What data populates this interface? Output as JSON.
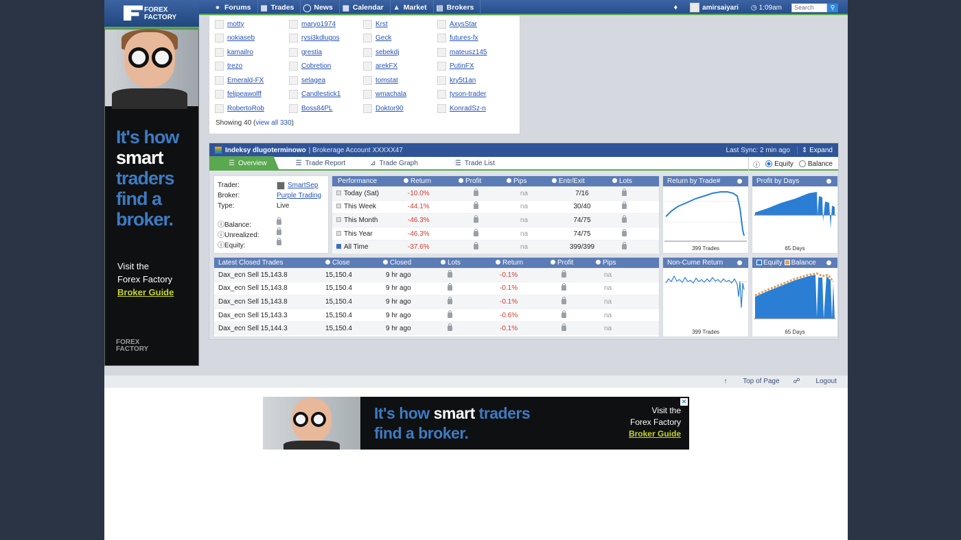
{
  "logo": {
    "line1": "FOREX",
    "line2": "FACTORY"
  },
  "nav": {
    "items": [
      {
        "label": "Forums",
        "icon": "chat-icon"
      },
      {
        "label": "Trades",
        "icon": "bars-icon"
      },
      {
        "label": "News",
        "icon": "globe-icon"
      },
      {
        "label": "Calendar",
        "icon": "calendar-icon"
      },
      {
        "label": "Market",
        "icon": "chart-icon"
      },
      {
        "label": "Brokers",
        "icon": "building-icon"
      }
    ],
    "username": "amirsaiyari",
    "time": "1:09am",
    "search_placeholder": "Search"
  },
  "side_ad": {
    "line1": "It's how",
    "line2": "smart",
    "line3": "traders",
    "line4": "find a",
    "line5": "broker.",
    "visit1": "Visit the",
    "visit2": "Forex Factory",
    "guide": "Broker Guide",
    "brand1": "FOREX",
    "brand2": "FACTORY"
  },
  "members": {
    "rows": [
      [
        "motty",
        "maryo1974",
        "Krst",
        "AxysStar"
      ],
      [
        "nokiaseb",
        "rysi3kdlugos",
        "Geck",
        "futures-fx"
      ],
      [
        "kamailro",
        "grestia",
        "sebekdj",
        "mateusz145"
      ],
      [
        "trezo",
        "Cobretion",
        "arekFX",
        "PutinFX"
      ],
      [
        "Emerald-FX",
        "selagea",
        "tomstat",
        "kry5t1an"
      ],
      [
        "felipeawolff",
        "Candlestick1",
        "wmachala",
        "tyson-trader"
      ],
      [
        "RobertoRob",
        "Boss84PL",
        "Doktor90",
        "KonradSz-n"
      ]
    ],
    "showing_prefix": "Showing 40 (",
    "view_all": "view all 330",
    "showing_suffix": ")"
  },
  "account": {
    "name": "Indeksy dlugoterminowo",
    "sub": "| Brokerage Account XXXXX47",
    "sync": "Last Sync: 2 min ago",
    "expand": "Expand",
    "tabs": [
      "Overview",
      "Trade Report",
      "Trade Graph",
      "Trade List"
    ],
    "toggle": {
      "equity": "Equity",
      "balance": "Balance"
    },
    "trader": {
      "trader_label": "Trader:",
      "trader_value": "SmartSep",
      "broker_label": "Broker:",
      "broker_value": "Purple Trading",
      "type_label": "Type:",
      "type_value": "Live",
      "balance_label": "Balance:",
      "unrealized_label": "Unrealized:",
      "equity_label": "Equity:"
    },
    "performance": {
      "headers": [
        "Performance",
        "Return",
        "Profit",
        "Pips",
        "Entr/Exit",
        "Lots"
      ],
      "rows": [
        {
          "period": "Today (Sat)",
          "return": "-10.0%",
          "pips": "na",
          "entr": "7/16"
        },
        {
          "period": "This Week",
          "return": "-44.1%",
          "pips": "na",
          "entr": "30/40"
        },
        {
          "period": "This Month",
          "return": "-46.3%",
          "pips": "na",
          "entr": "74/75"
        },
        {
          "period": "This Year",
          "return": "-46.3%",
          "pips": "na",
          "entr": "74/75"
        },
        {
          "period": "All Time",
          "return": "-37.6%",
          "pips": "na",
          "entr": "399/399"
        }
      ]
    },
    "closed": {
      "headers": [
        "Latest Closed Trades",
        "Close",
        "Closed",
        "Lots",
        "Return",
        "Profit",
        "Pips"
      ],
      "rows": [
        {
          "trade": "Dax_ecn Sell 15,143.8",
          "close": "15,150.4",
          "closed": "9 hr ago",
          "ret": "-0.1%",
          "pips": "na"
        },
        {
          "trade": "Dax_ecn Sell 15,143.8",
          "close": "15,150.4",
          "closed": "9 hr ago",
          "ret": "-0.1%",
          "pips": "na"
        },
        {
          "trade": "Dax_ecn Sell 15,143.8",
          "close": "15,150.4",
          "closed": "9 hr ago",
          "ret": "-0.1%",
          "pips": "na"
        },
        {
          "trade": "Dax_ecn Sell 15,143.3",
          "close": "15,150.4",
          "closed": "9 hr ago",
          "ret": "-0.6%",
          "pips": "na"
        },
        {
          "trade": "Dax_ecn Sell 15,144.3",
          "close": "15,150.4",
          "closed": "9 hr ago",
          "ret": "-0.1%",
          "pips": "na"
        }
      ]
    },
    "minis": {
      "return_by_trade": {
        "title": "Return by Trade#",
        "footer": "399 Trades"
      },
      "profit_by_days": {
        "title": "Profit by Days",
        "footer": "65 Days"
      },
      "non_cume": {
        "title": "Non-Cume Return",
        "footer": "399 Trades"
      },
      "equity_balance": {
        "equity": "Equity",
        "balance": "Balance",
        "footer": "65 Days"
      }
    },
    "colors": {
      "accent": "#5aa84f",
      "header": "#2f5497",
      "negative": "#d23a2f",
      "series": "#2a7fd4",
      "balance": "#e0a05a"
    }
  },
  "footer": {
    "top": "Top of Page",
    "logout": "Logout"
  },
  "bottom_ad": {
    "t1a": "It's how ",
    "t1b": "smart",
    "t1c": " traders",
    "t2": "find a broker.",
    "v1": "Visit the",
    "v2": "Forex Factory",
    "v3": "Broker Guide"
  }
}
